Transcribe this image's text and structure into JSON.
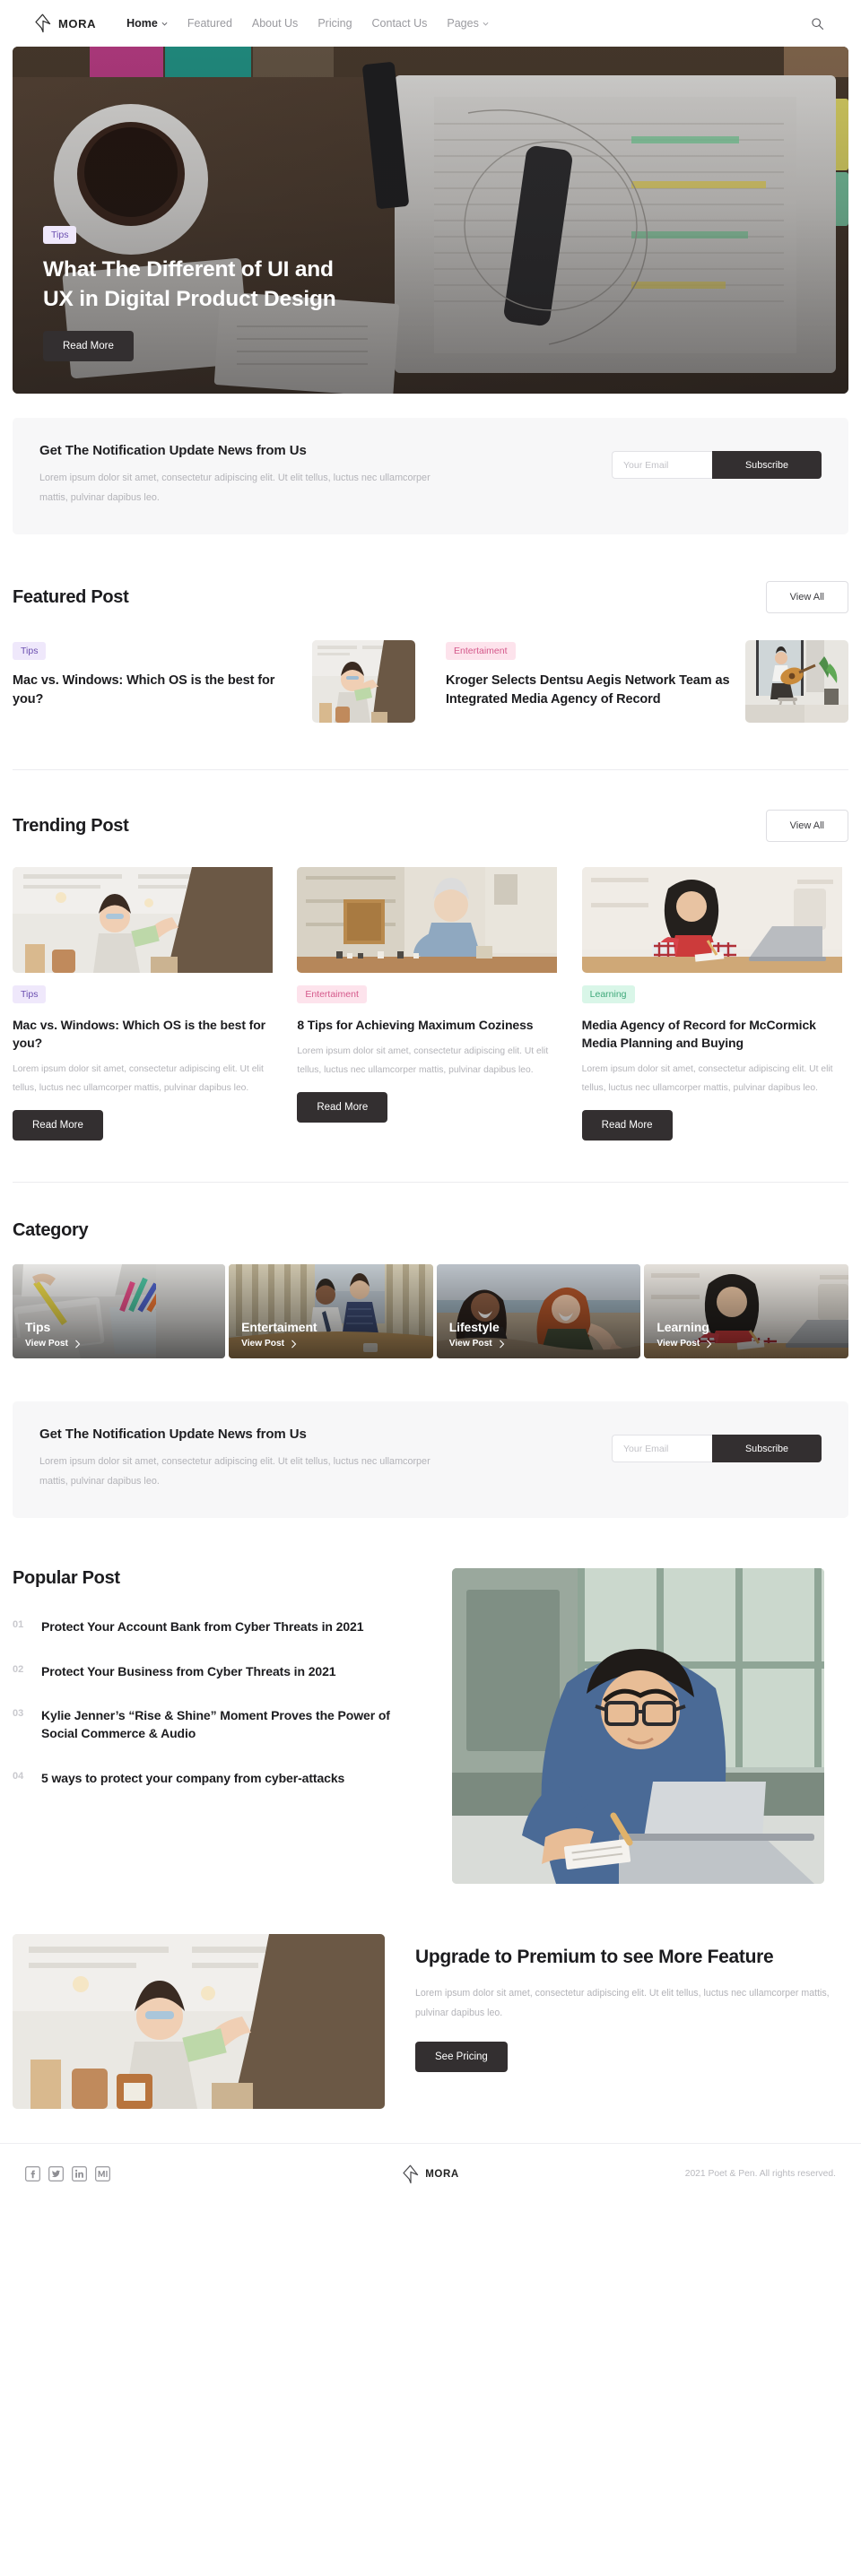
{
  "brand": {
    "name": "MORA",
    "icon": "pen-nib-logo-icon"
  },
  "nav": {
    "items": [
      {
        "label": "Home",
        "active": true,
        "has_caret": true
      },
      {
        "label": "Featured",
        "active": false,
        "has_caret": false
      },
      {
        "label": "About Us",
        "active": false,
        "has_caret": false
      },
      {
        "label": "Pricing",
        "active": false,
        "has_caret": false
      },
      {
        "label": "Contact Us",
        "active": false,
        "has_caret": false
      },
      {
        "label": "Pages",
        "active": false,
        "has_caret": true
      }
    ],
    "search_icon": "search-icon"
  },
  "hero": {
    "badge": "Tips",
    "title": "What The Different of UI and UX in Digital Product Design",
    "cta": "Read More"
  },
  "newsletter": {
    "title": "Get The Notification Update News from Us",
    "description": "Lorem ipsum dolor sit amet, consectetur adipiscing elit. Ut elit tellus, luctus nec ullamcorper mattis, pulvinar dapibus leo.",
    "input_placeholder": "Your Email",
    "submit_label": "Subscribe"
  },
  "featured": {
    "title": "Featured Post",
    "view_all": "View All",
    "posts": [
      {
        "badge": "Tips",
        "badge_color": "purple",
        "title": "Mac vs. Windows: Which OS is the best for you?",
        "image": "woman-shop-payment-photo"
      },
      {
        "badge": "Entertaiment",
        "badge_color": "pink",
        "title": "Kroger Selects Dentsu Aegis Network Team as Integrated Media Agency of Record",
        "image": "man-guitar-window-photo"
      }
    ]
  },
  "trending": {
    "title": "Trending Post",
    "view_all": "View All",
    "posts": [
      {
        "badge": "Tips",
        "badge_color": "purple",
        "title": "Mac vs. Windows: Which OS is the best for you?",
        "description": "Lorem ipsum dolor sit amet, consectetur adipiscing elit. Ut elit tellus, luctus nec ullamcorper mattis, pulvinar dapibus leo.",
        "cta": "Read More",
        "image": "woman-shop-payment-photo"
      },
      {
        "badge": "Entertaiment",
        "badge_color": "pink",
        "title": "8 Tips for Achieving Maximum Coziness",
        "description": "Lorem ipsum dolor sit amet, consectetur adipiscing elit. Ut elit tellus, luctus nec ullamcorper mattis, pulvinar dapibus leo.",
        "cta": "Read More",
        "image": "elderly-man-chess-photo"
      },
      {
        "badge": "Learning",
        "badge_color": "green",
        "title": "Media Agency of Record for McCormick Media Planning and Buying",
        "description": "Lorem ipsum dolor sit amet, consectetur adipiscing elit. Ut elit tellus, luctus nec ullamcorper mattis, pulvinar dapibus leo.",
        "cta": "Read More",
        "image": "woman-laptop-plaid-photo"
      }
    ]
  },
  "category": {
    "title": "Category",
    "link_label": "View Post",
    "items": [
      {
        "name": "Tips",
        "image": "hand-writing-pens-photo"
      },
      {
        "name": "Entertaiment",
        "image": "office-pair-table-photo"
      },
      {
        "name": "Lifestyle",
        "image": "two-women-laughing-photo"
      },
      {
        "name": "Learning",
        "image": "woman-laptop-plaid-photo"
      }
    ]
  },
  "newsletter2": {
    "title": "Get The Notification Update News from Us",
    "description": "Lorem ipsum dolor sit amet, consectetur adipiscing elit. Ut elit tellus, luctus nec ullamcorper mattis, pulvinar dapibus leo.",
    "input_placeholder": "Your Email",
    "submit_label": "Subscribe"
  },
  "popular": {
    "title": "Popular Post",
    "image": "man-glasses-laptop-notebook-photo",
    "items": [
      {
        "num": "01",
        "title": "Protect Your Account Bank from Cyber Threats in 2021"
      },
      {
        "num": "02",
        "title": "Protect Your Business from Cyber Threats in 2021"
      },
      {
        "num": "03",
        "title": "Kylie Jenner’s “Rise & Shine” Moment Proves the Power of Social Commerce & Audio"
      },
      {
        "num": "04",
        "title": "5 ways to protect your company from cyber-attacks"
      }
    ]
  },
  "premium": {
    "image": "woman-shop-payment-photo",
    "title": "Upgrade to Premium to see More Feature",
    "description": "Lorem ipsum dolor sit amet, consectetur adipiscing elit. Ut elit tellus, luctus nec ullamcorper mattis, pulvinar dapibus leo.",
    "cta": "See Pricing"
  },
  "footer": {
    "socials": [
      {
        "name": "facebook-icon"
      },
      {
        "name": "twitter-icon"
      },
      {
        "name": "linkedin-icon"
      },
      {
        "name": "medium-icon"
      }
    ],
    "brand": "MORA",
    "copyright": "2021 Poet & Pen. All rights reserved."
  },
  "colors": {
    "dark_button": "#332f30",
    "badge_purple_bg": "#efe8fb",
    "badge_purple_text": "#6b4fb0",
    "badge_pink_bg": "#fde3ec",
    "badge_pink_text": "#d4588a",
    "badge_green_bg": "#d9f6e8",
    "badge_green_text": "#3fa87a",
    "panel_bg": "#f7f7f8",
    "muted_text": "#b3b3b8"
  }
}
